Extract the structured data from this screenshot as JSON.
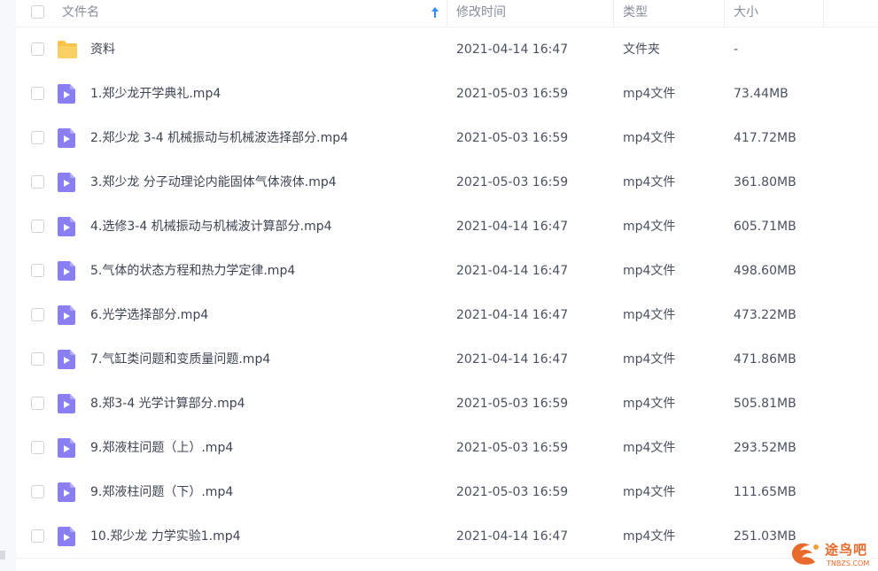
{
  "header": {
    "name": "文件名",
    "modified": "修改时间",
    "type": "类型",
    "size": "大小"
  },
  "colors": {
    "folder": "#f9c34a",
    "video_icon": "#8a7ff2",
    "sort_arrow": "#2f8ef7",
    "watermark": "#e86a2c"
  },
  "rows": [
    {
      "icon": "folder-icon",
      "name": "资料",
      "date": "2021-04-14 16:47",
      "type": "文件夹",
      "size": "-"
    },
    {
      "icon": "video-file-icon",
      "name": "1.郑少龙开学典礼.mp4",
      "date": "2021-05-03 16:59",
      "type": "mp4文件",
      "size": "73.44MB"
    },
    {
      "icon": "video-file-icon",
      "name": "2.郑少龙 3-4 机械振动与机械波选择部分.mp4",
      "date": "2021-05-03 16:59",
      "type": "mp4文件",
      "size": "417.72MB"
    },
    {
      "icon": "video-file-icon",
      "name": "3.郑少龙 分子动理论内能固体气体液体.mp4",
      "date": "2021-05-03 16:59",
      "type": "mp4文件",
      "size": "361.80MB"
    },
    {
      "icon": "video-file-icon",
      "name": "4.选修3-4 机械振动与机械波计算部分.mp4",
      "date": "2021-04-14 16:47",
      "type": "mp4文件",
      "size": "605.71MB"
    },
    {
      "icon": "video-file-icon",
      "name": "5.气体的状态方程和热力学定律.mp4",
      "date": "2021-04-14 16:47",
      "type": "mp4文件",
      "size": "498.60MB"
    },
    {
      "icon": "video-file-icon",
      "name": "6.光学选择部分.mp4",
      "date": "2021-04-14 16:47",
      "type": "mp4文件",
      "size": "473.22MB"
    },
    {
      "icon": "video-file-icon",
      "name": "7.气缸类问题和变质量问题.mp4",
      "date": "2021-04-14 16:47",
      "type": "mp4文件",
      "size": "471.86MB"
    },
    {
      "icon": "video-file-icon",
      "name": "8.郑3-4 光学计算部分.mp4",
      "date": "2021-05-03 16:59",
      "type": "mp4文件",
      "size": "505.81MB"
    },
    {
      "icon": "video-file-icon",
      "name": "9.郑液柱问题（上）.mp4",
      "date": "2021-05-03 16:59",
      "type": "mp4文件",
      "size": "293.52MB"
    },
    {
      "icon": "video-file-icon",
      "name": "9.郑液柱问题（下）.mp4",
      "date": "2021-05-03 16:59",
      "type": "mp4文件",
      "size": "111.65MB"
    },
    {
      "icon": "video-file-icon",
      "name": "10.郑少龙 力学实验1.mp4",
      "date": "2021-04-14 16:47",
      "type": "mp4文件",
      "size": "251.03MB"
    }
  ],
  "watermark": {
    "text": "途鸟吧",
    "sub": "TNBZS.COM"
  }
}
